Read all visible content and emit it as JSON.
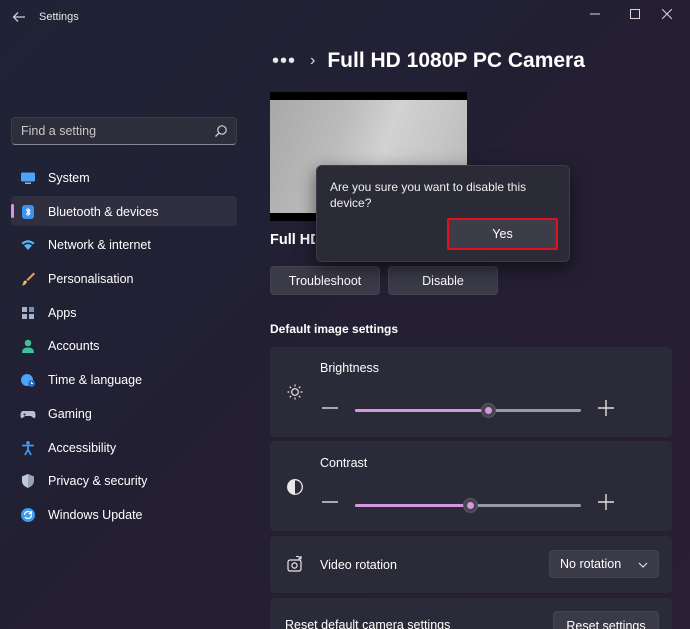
{
  "window": {
    "title": "Settings",
    "controls": [
      "minimize",
      "maximize",
      "close"
    ]
  },
  "search": {
    "placeholder": "Find a setting"
  },
  "sidebar": {
    "items": [
      {
        "label": "System",
        "icon": "monitor-icon",
        "color": "#4da3f5"
      },
      {
        "label": "Bluetooth & devices",
        "icon": "bluetooth-icon",
        "color": "#3b93f0",
        "active": true
      },
      {
        "label": "Network & internet",
        "icon": "wifi-icon",
        "color": "#5bb6f7"
      },
      {
        "label": "Personalisation",
        "icon": "brush-icon",
        "color": "#e6a24a"
      },
      {
        "label": "Apps",
        "icon": "apps-icon",
        "color": "#a9b3c4"
      },
      {
        "label": "Accounts",
        "icon": "person-icon",
        "color": "#3cc29a"
      },
      {
        "label": "Time & language",
        "icon": "globe-clock-icon",
        "color": "#4da3f5"
      },
      {
        "label": "Gaming",
        "icon": "gamepad-icon",
        "color": "#b9bfcc"
      },
      {
        "label": "Accessibility",
        "icon": "accessibility-icon",
        "color": "#3d9bf0"
      },
      {
        "label": "Privacy & security",
        "icon": "shield-icon",
        "color": "#9aa3b3"
      },
      {
        "label": "Windows Update",
        "icon": "sync-icon",
        "color": "#3d9bf0"
      }
    ]
  },
  "header": {
    "breadcrumb_more": "•••",
    "page_title": "Full HD 1080P PC Camera"
  },
  "device": {
    "name_visible": "Full HD",
    "troubleshoot_label": "Troubleshoot",
    "disable_label": "Disable"
  },
  "dialog": {
    "message": "Are you sure you want to disable this device?",
    "yes_label": "Yes"
  },
  "image_settings": {
    "heading": "Default image settings",
    "brightness": {
      "label": "Brightness",
      "value": 0.59
    },
    "contrast": {
      "label": "Contrast",
      "value": 0.51
    },
    "rotation": {
      "label": "Video rotation",
      "selected": "No rotation"
    },
    "reset": {
      "label": "Reset default camera settings",
      "button_label": "Reset settings"
    }
  },
  "colors": {
    "accent": "#d695e0",
    "highlight": "#e0131c"
  }
}
